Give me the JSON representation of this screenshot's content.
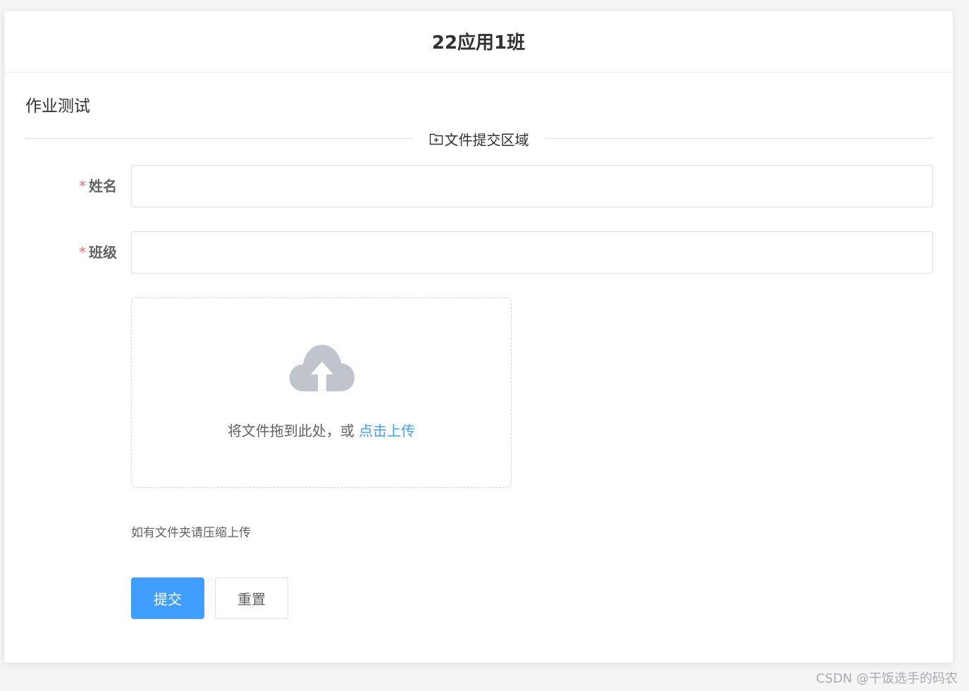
{
  "card": {
    "title": "22应用1班"
  },
  "section": {
    "title": "作业测试"
  },
  "divider": {
    "text": "文件提交区域",
    "icon": "folder-add-icon"
  },
  "form": {
    "name_label": "姓名",
    "name_value": "",
    "class_label": "班级",
    "class_value": "",
    "required_mark": "*"
  },
  "upload": {
    "icon": "upload-cloud-icon",
    "text": "将文件拖到此处，或 ",
    "link": "点击上传",
    "tip": "如有文件夹请压缩上传"
  },
  "buttons": {
    "submit": "提交",
    "reset": "重置"
  },
  "watermark": "CSDN @干饭选手的码农",
  "colors": {
    "primary": "#409eff",
    "required": "#f56c6c",
    "icon_gray": "#c0c4cc"
  }
}
